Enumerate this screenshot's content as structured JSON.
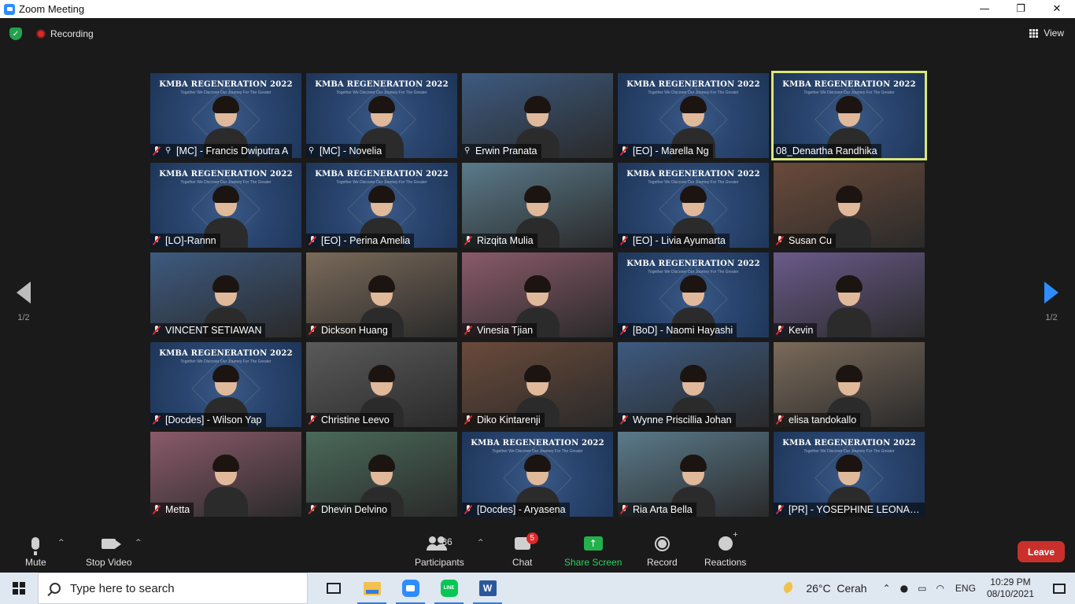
{
  "window": {
    "title": "Zoom Meeting",
    "minimize": "—",
    "maximize": "❐",
    "close": "✕"
  },
  "topbar": {
    "recording_label": "Recording",
    "view_label": "View"
  },
  "nav": {
    "prev_page": "1/2",
    "next_page": "1/2"
  },
  "tile_overlay": {
    "title": "KMBA REGENERATION 2022",
    "subtitle": "Together We Discover Our Journey For The Greater"
  },
  "participants": [
    {
      "name": "[MC] - Francis Dwiputra A",
      "pinned": true,
      "muted": true,
      "kmba": true
    },
    {
      "name": "[MC] - Novelia",
      "pinned": true,
      "muted": false,
      "kmba": true
    },
    {
      "name": "Erwin Pranata",
      "pinned": true,
      "muted": false,
      "kmba": false
    },
    {
      "name": "[EO] - Marella Ng",
      "pinned": false,
      "muted": true,
      "kmba": true
    },
    {
      "name": "08_Denartha Randhika",
      "pinned": false,
      "muted": false,
      "kmba": true
    },
    {
      "name": "[LO]-Rannn",
      "pinned": false,
      "muted": true,
      "kmba": true
    },
    {
      "name": "[EO] - Perina Amelia",
      "pinned": false,
      "muted": true,
      "kmba": true
    },
    {
      "name": "Rizqita Mulia",
      "pinned": false,
      "muted": true,
      "kmba": false
    },
    {
      "name": "[EO] - Livia Ayumarta",
      "pinned": false,
      "muted": true,
      "kmba": true
    },
    {
      "name": "Susan Cu",
      "pinned": false,
      "muted": true,
      "kmba": false
    },
    {
      "name": "VINCENT SETIAWAN",
      "pinned": false,
      "muted": true,
      "kmba": false
    },
    {
      "name": "Dickson Huang",
      "pinned": false,
      "muted": true,
      "kmba": false
    },
    {
      "name": "Vinesia Tjian",
      "pinned": false,
      "muted": true,
      "kmba": false
    },
    {
      "name": "[BoD] - Naomi Hayashi",
      "pinned": false,
      "muted": true,
      "kmba": true
    },
    {
      "name": "Kevin",
      "pinned": false,
      "muted": true,
      "kmba": false
    },
    {
      "name": "[Docdes] - Wilson Yap",
      "pinned": false,
      "muted": true,
      "kmba": true
    },
    {
      "name": "Christine Leevo",
      "pinned": false,
      "muted": true,
      "kmba": false
    },
    {
      "name": "Diko Kintarenji",
      "pinned": false,
      "muted": true,
      "kmba": false
    },
    {
      "name": "Wynne Priscillia Johan",
      "pinned": false,
      "muted": true,
      "kmba": false
    },
    {
      "name": "elisa tandokallo",
      "pinned": false,
      "muted": true,
      "kmba": false
    },
    {
      "name": "Metta",
      "pinned": false,
      "muted": true,
      "kmba": false
    },
    {
      "name": "Dhevin Delvino",
      "pinned": false,
      "muted": true,
      "kmba": false
    },
    {
      "name": "[Docdes] - Aryasena",
      "pinned": false,
      "muted": true,
      "kmba": true
    },
    {
      "name": "Ria Arta Bella",
      "pinned": false,
      "muted": true,
      "kmba": false
    },
    {
      "name": "[PR] - YOSEPHINE LEONAR...",
      "pinned": false,
      "muted": true,
      "kmba": true
    }
  ],
  "active_speaker": "08_Denartha Randhika",
  "toolbar": {
    "mute_label": "Mute",
    "video_label": "Stop Video",
    "participants_label": "Participants",
    "participants_count": "36",
    "chat_label": "Chat",
    "chat_badge": "5",
    "share_label": "Share Screen",
    "record_label": "Record",
    "reactions_label": "Reactions",
    "leave_label": "Leave"
  },
  "taskbar": {
    "search_placeholder": "Type here to search",
    "apps": [
      "task-view",
      "file-explorer",
      "zoom",
      "line",
      "word"
    ],
    "line_text": "LINE",
    "word_text": "W",
    "weather_temp": "26°C",
    "weather_text": "Cerah",
    "lang": "ENG",
    "time": "10:29 PM",
    "date": "08/10/2021"
  },
  "colors": {
    "accent": "#2d8cff",
    "share_green": "#23b04d",
    "leave_red": "#c9302c",
    "speaker_outline": "#d9e77a"
  }
}
